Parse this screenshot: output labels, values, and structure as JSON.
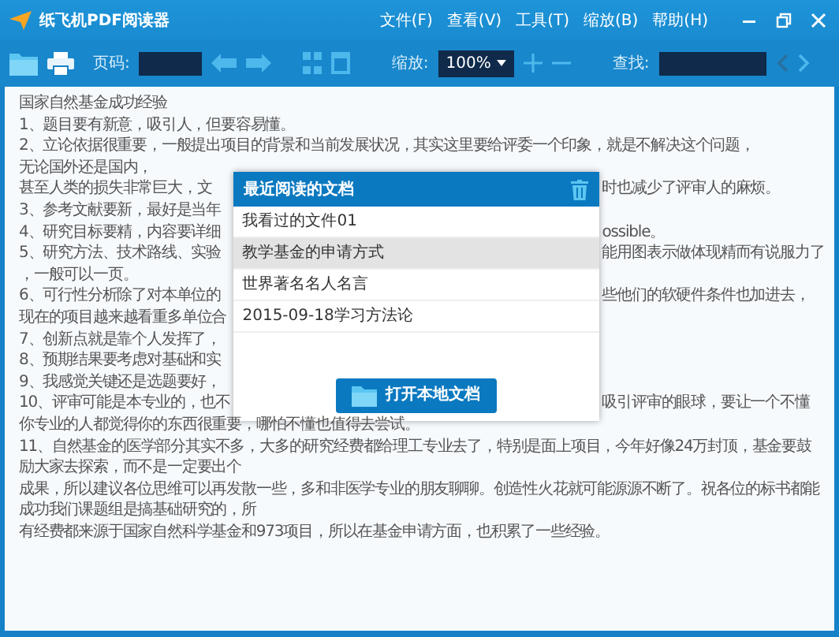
{
  "window": {
    "title": "纸飞机PDF阅读器"
  },
  "menu": [
    "文件(F)",
    "查看(V)",
    "工具(T)",
    "缩放(B)",
    "帮助(H)"
  ],
  "toolbar": {
    "page_label": "页码:",
    "zoom_label": "缩放:",
    "zoom_value": "100%",
    "find_label": "查找:",
    "find_prev_disabled": true,
    "find_next_disabled": false
  },
  "document": {
    "lines_before": [
      "国家自然基金成功经验",
      "1、题目要有新意，吸引人，但要容易懂。",
      "2、立论依据很重要，一般提出项目的背景和当前发展状况，其实这里要给评委一个印象，就是不解决这个问题，",
      "无论国外还是国内，"
    ],
    "lines_beside_dialog": [
      {
        "left": "甚至人类的损失非常巨大，文",
        "right": "时也减少了评审人的麻烦。"
      },
      {
        "left": "3、参考文献要新，最好是当年"
      },
      {
        "left": "4、研究目标要精，内容要详细",
        "right": "ossible。"
      },
      {
        "left": "5、研究方法、技术路线、实验",
        "right": "能用图表示做体现精而有说服力了"
      },
      {
        "left": "，一般可以一页。"
      },
      {
        "left": "6、可行性分析除了对本单位的",
        "right": "些他们的软硬件条件也加进去，"
      },
      {
        "left": "现在的项目越来越看重多单位合"
      },
      {
        "left": "7、创新点就是靠个人发挥了，"
      },
      {
        "left": "8、预期结果要考虑对基础和实"
      },
      {
        "left": "9、我感觉关键还是选题要好，"
      },
      {
        "left": "10、评审可能是本专业的，也不",
        "right": "吸引评审的眼球，要让一个不懂"
      }
    ],
    "lines_after": [
      "你专业的人都觉得你的东西很重要，哪怕不懂也值得去尝试。",
      "11、自然基金的医学部分其实不多，大多的研究经费都给理工专业去了，特别是面上项目，今年好像24万封顶，基金要鼓励大家去探索，而不是一定要出个",
      "成果，所以建议各位思维可以再发散一些，多和非医学专业的朋友聊聊。创造性火花就可能源源不断了。祝各位的标书都能成功我们课题组是搞基础研究的，所",
      "有经费都来源于国家自然科学基金和973项目，所以在基金申请方面，也积累了一些经验。"
    ]
  },
  "recent_dialog": {
    "title": "最近阅读的文档",
    "items": [
      {
        "label": "我看过的文件01",
        "selected": false
      },
      {
        "label": "教学基金的申请方式",
        "selected": true
      },
      {
        "label": "世界著名名人名言",
        "selected": false
      },
      {
        "label": "2015-09-18学习方法论",
        "selected": false
      }
    ],
    "open_button": "打开本地文档"
  }
}
